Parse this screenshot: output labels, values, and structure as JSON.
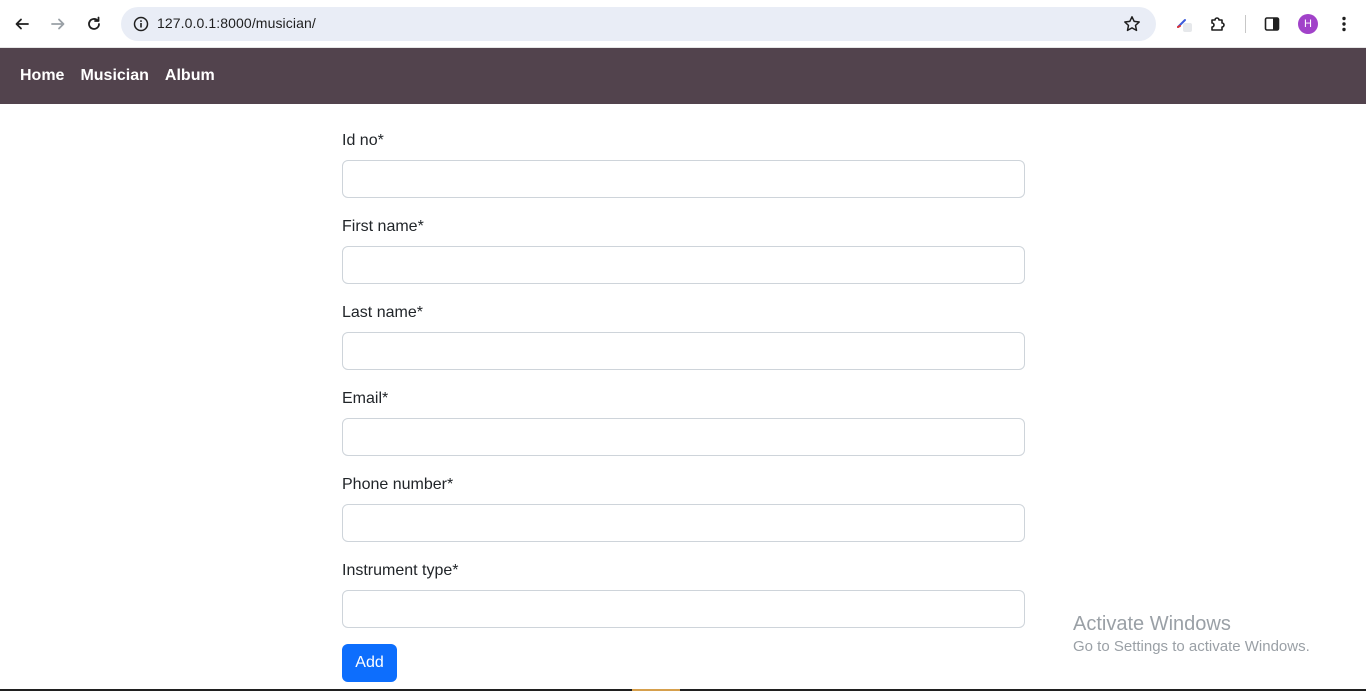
{
  "browser": {
    "url": "127.0.0.1:8000/musician/",
    "profile_initial": "H"
  },
  "navbar": {
    "items": [
      "Home",
      "Musician",
      "Album"
    ]
  },
  "form": {
    "fields": [
      {
        "label": "Id no*",
        "value": ""
      },
      {
        "label": "First name*",
        "value": ""
      },
      {
        "label": "Last name*",
        "value": ""
      },
      {
        "label": "Email*",
        "value": ""
      },
      {
        "label": "Phone number*",
        "value": ""
      },
      {
        "label": "Instrument type*",
        "value": ""
      }
    ],
    "submit_label": "Add"
  },
  "watermark": {
    "title": "Activate Windows",
    "subtitle": "Go to Settings to activate Windows."
  },
  "colors": {
    "navbar_bg": "#52434d",
    "button_primary": "#0d6efd",
    "avatar": "#a142c9"
  }
}
